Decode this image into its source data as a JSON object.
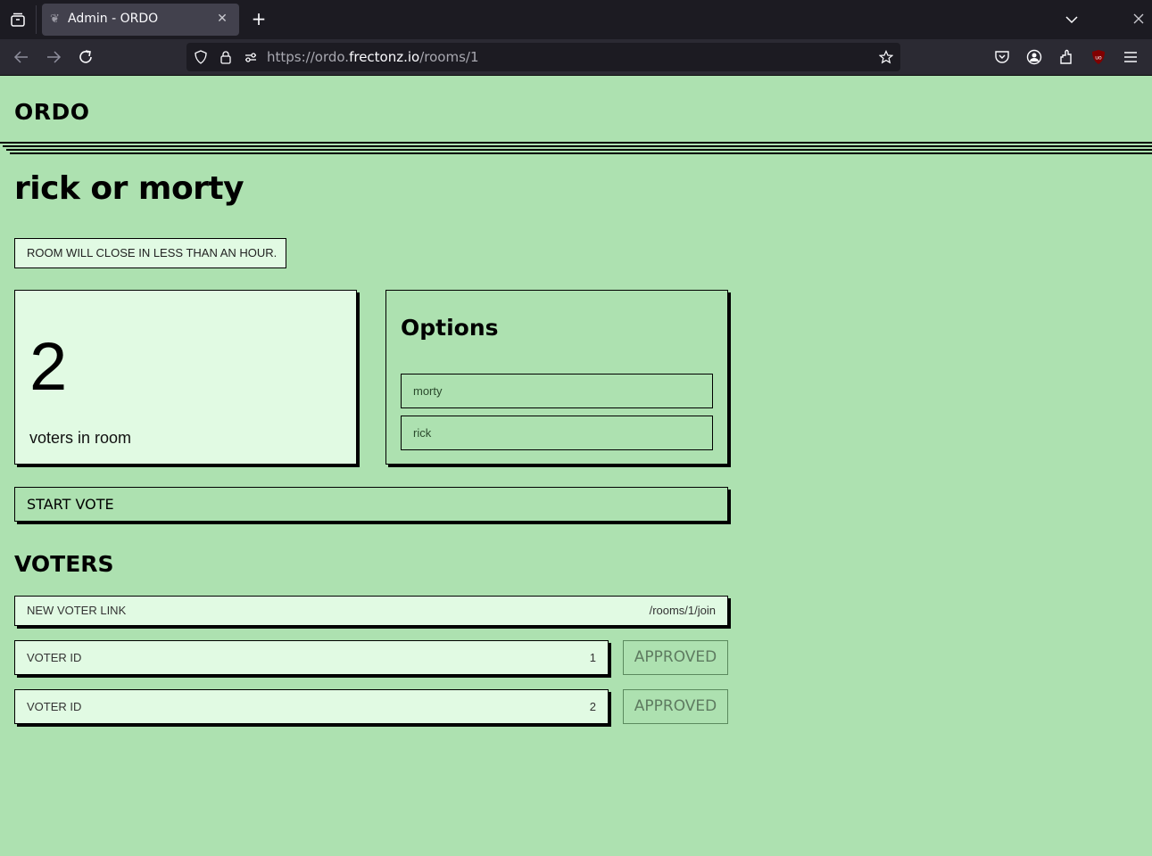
{
  "browser": {
    "tab": {
      "title": "Admin - ORDO",
      "favicon": "ordo-favicon"
    },
    "url": {
      "scheme": "https://",
      "subdomain": "ordo.",
      "host": "frectonz.io",
      "path": "/rooms/1"
    },
    "icons": [
      "tab-list-icon",
      "close-tab-icon",
      "new-tab-icon",
      "list-all-tabs-icon",
      "window-close-icon",
      "back-icon",
      "forward-icon",
      "reload-icon",
      "shield-icon",
      "lock-icon",
      "permissions-icon",
      "bookmark-star-icon",
      "pocket-icon",
      "account-icon",
      "extensions-icon",
      "ublock-icon",
      "menu-icon"
    ]
  },
  "header": {
    "logo": "ORDO"
  },
  "room": {
    "title": "rick or morty",
    "notice": "ROOM WILL CLOSE IN LESS THAN AN HOUR.",
    "voter_count": "2",
    "voter_count_label": "voters in room",
    "options_title": "Options",
    "options": [
      "morty",
      "rick"
    ],
    "start_vote_label": "START VOTE"
  },
  "voters": {
    "title": "VOTERS",
    "new_link_label": "NEW VOTER LINK",
    "new_link_value": "/rooms/1/join",
    "list": [
      {
        "label": "VOTER ID",
        "id": "1",
        "status": "APPROVED"
      },
      {
        "label": "VOTER ID",
        "id": "2",
        "status": "APPROVED"
      }
    ]
  },
  "colors": {
    "page_bg": "#ade1b0",
    "card_light": "#e1fae3",
    "border": "#000000",
    "disabled_text": "#5e7b60"
  }
}
